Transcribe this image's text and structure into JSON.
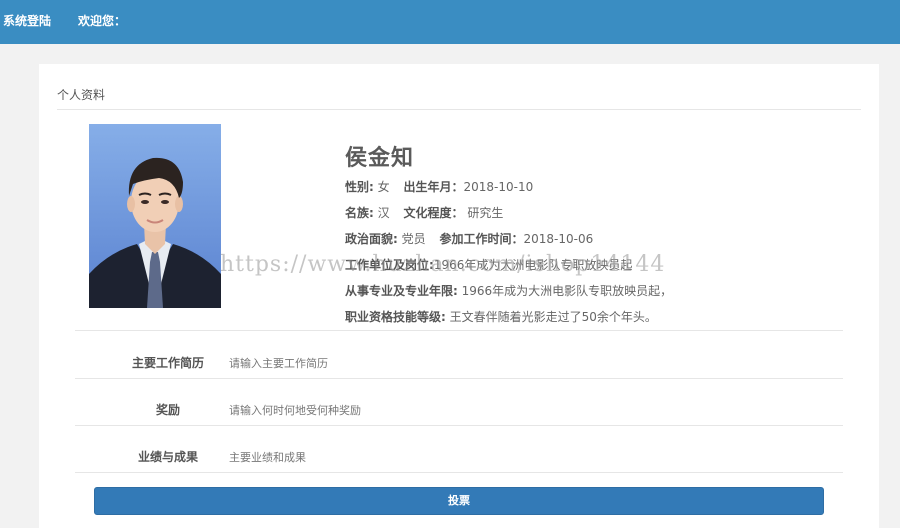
{
  "topbar": {
    "login_label": "系统登陆",
    "welcome_label": "欢迎您："
  },
  "profile": {
    "section_title": "个人资料",
    "photo_icon": "portrait-photo",
    "name": "侯金知",
    "gender_label": "性别:",
    "gender": "女",
    "birth_label": "出生年月：",
    "birth": "2018-10-10",
    "ethnicity_label": "名族:",
    "ethnicity": "汉",
    "education_label": "文化程度：",
    "education": "研究生",
    "political_label": "政治面貌:",
    "political": "党员",
    "work_start_label": "参加工作时间：",
    "work_start": "2018-10-06",
    "employer_label": "工作单位及岗位:",
    "employer": "1966年成为大洲电影队专职放映员起",
    "specialty_label": "从事专业及专业年限:",
    "specialty": "1966年成为大洲电影队专职放映员起，",
    "skill_label": "职业资格技能等级:",
    "skill": "王文春伴随着光影走过了50余个年头。"
  },
  "details": [
    {
      "label": "主要工作简历",
      "value": "请输入主要工作简历"
    },
    {
      "label": "奖励",
      "value": "请输入何时何地受何种奖励"
    },
    {
      "label": "业绩与成果",
      "value": "主要业绩和成果"
    }
  ],
  "actions": {
    "vote_label": "投票"
  },
  "watermark": "https://www.huzhan.com/ishop14144",
  "colors": {
    "topbar": "#3a8dc2",
    "button": "#337ab7",
    "background": "#f2f2f2"
  }
}
